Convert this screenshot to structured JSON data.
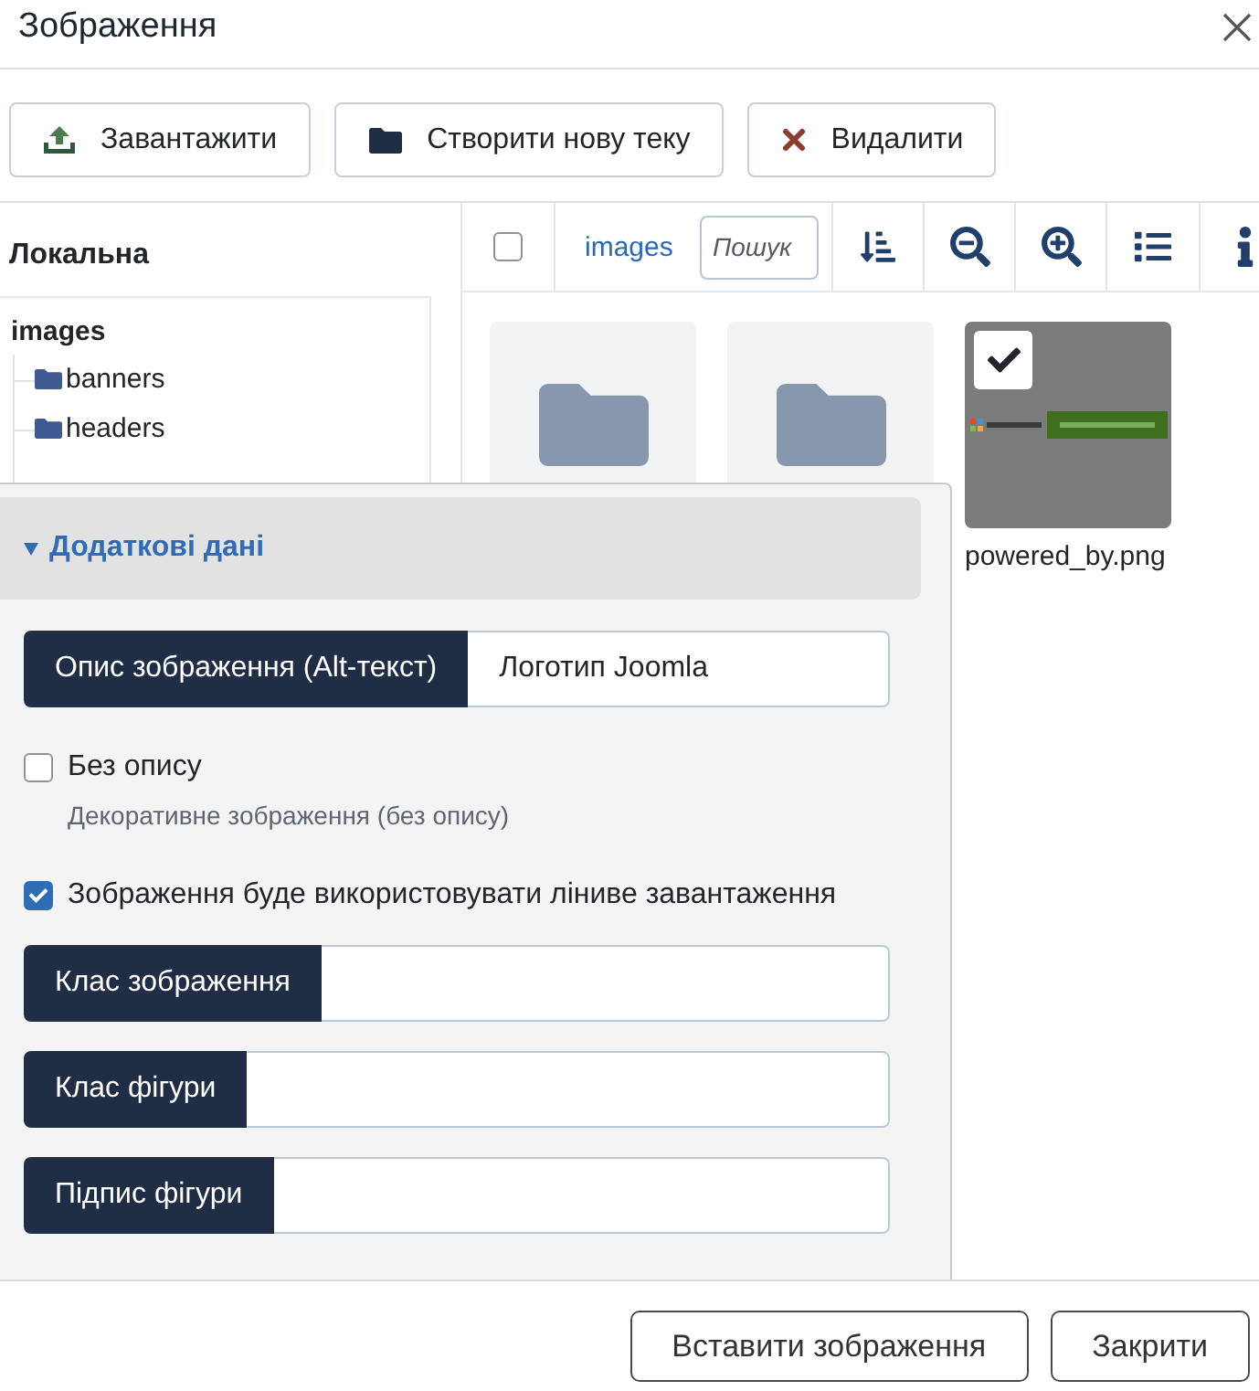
{
  "window": {
    "title": "Зображення"
  },
  "toolbar": {
    "buttons": [
      {
        "kind": "upload",
        "label": "Завантажити"
      },
      {
        "kind": "new-folder",
        "label": "Створити нову теку"
      },
      {
        "kind": "delete",
        "label": "Видалити"
      }
    ]
  },
  "sidebar": {
    "title": "Локальна",
    "tree": [
      {
        "label": "images",
        "children": [
          {
            "label": "banners"
          },
          {
            "label": "headers"
          }
        ]
      }
    ]
  },
  "browser": {
    "select_all": {
      "checked": false
    },
    "breadcrumb": "images",
    "search": {
      "placeholder": "Пошук"
    },
    "items": [
      {
        "kind": "folder",
        "selected": false
      },
      {
        "kind": "folder",
        "selected": false
      },
      {
        "kind": "image",
        "name": "powered_by.png",
        "selected": true
      }
    ]
  },
  "details": {
    "section": {
      "title": "Додаткові дані",
      "expanded": true
    },
    "alt_text": {
      "label": "Опис зображення (Alt-текст)",
      "value": "Логотип Joomla"
    },
    "options": [
      {
        "label": "Без опису",
        "checked": false,
        "hint": "Декоративне зображення (без опису)"
      },
      {
        "label": "Зображення буде використовувати ліниве завантаження",
        "checked": true
      }
    ],
    "fields": [
      {
        "label": "Клас зображення"
      },
      {
        "label": "Клас фігури"
      },
      {
        "label": "Підпис фігури"
      }
    ]
  },
  "footer": {
    "buttons": [
      {
        "label": "Вставити зображення"
      },
      {
        "label": "Закрити"
      }
    ]
  }
}
